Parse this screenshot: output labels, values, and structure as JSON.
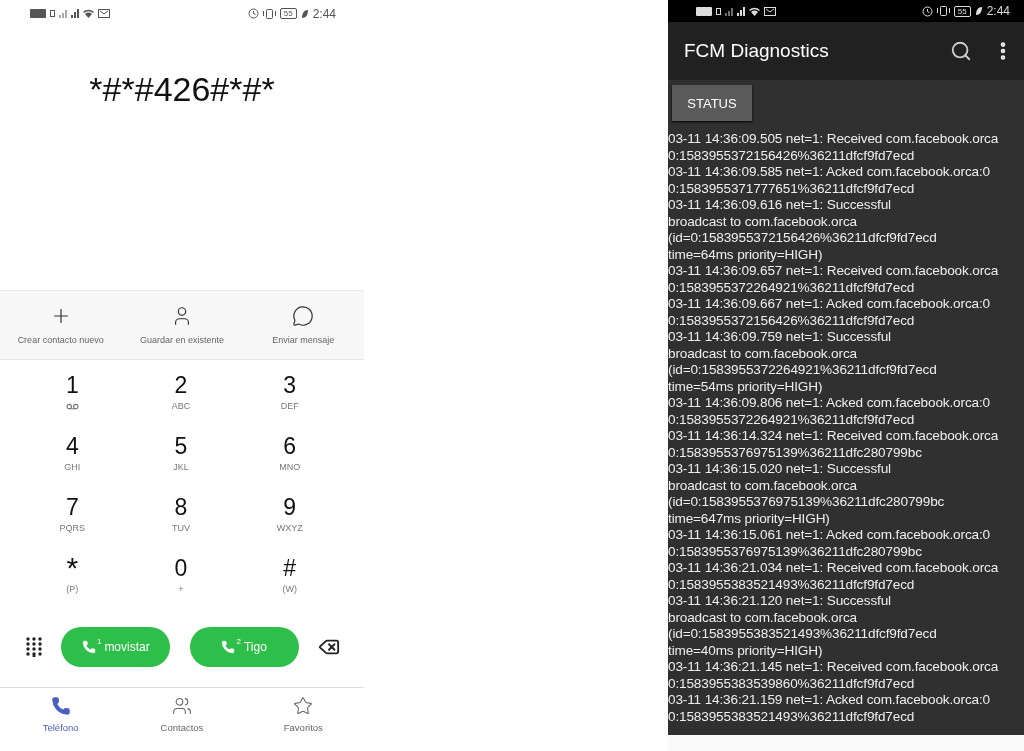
{
  "dialer": {
    "status_bar": {
      "battery": "55",
      "time": "2:44"
    },
    "number": "*#*#426#*#*",
    "actions": [
      {
        "kind": "add",
        "label": "Crear contacto nuevo"
      },
      {
        "kind": "person",
        "label": "Guardar en existente"
      },
      {
        "kind": "message",
        "label": "Enviar mensaje"
      }
    ],
    "keys": [
      {
        "digit": "1",
        "kind": "voicemail"
      },
      {
        "digit": "2",
        "letters": "ABC"
      },
      {
        "digit": "3",
        "letters": "DEF"
      },
      {
        "digit": "4",
        "letters": "GHI"
      },
      {
        "digit": "5",
        "letters": "JKL"
      },
      {
        "digit": "6",
        "letters": "MNO"
      },
      {
        "digit": "7",
        "letters": "PQRS"
      },
      {
        "digit": "8",
        "letters": "TUV"
      },
      {
        "digit": "9",
        "letters": "WXYZ"
      },
      {
        "digit": "*",
        "letters": "(P)"
      },
      {
        "digit": "0",
        "letters": "+"
      },
      {
        "digit": "#",
        "letters": "(W)"
      }
    ],
    "call_buttons": [
      {
        "sim": "1",
        "label": "movistar"
      },
      {
        "sim": "2",
        "label": "Tigo"
      }
    ],
    "tabs": [
      {
        "kind": "phone",
        "label": "Teléfono",
        "selected": true
      },
      {
        "kind": "contacts",
        "label": "Contactos",
        "selected": false
      },
      {
        "kind": "star",
        "label": "Favoritos",
        "selected": false
      }
    ]
  },
  "diagnostics": {
    "status_bar": {
      "battery": "55",
      "time": "2:44"
    },
    "title": "FCM Diagnostics",
    "button": "STATUS",
    "log": [
      "03-11 14:36:09.505 net=1: Received com.facebook.orca",
      "0:1583955372156426%36211dfcf9fd7ecd",
      "03-11 14:36:09.585 net=1: Acked com.facebook.orca:0",
      "0:1583955371777651%36211dfcf9fd7ecd",
      "03-11 14:36:09.616 net=1: Successful",
      "broadcast to com.facebook.orca",
      "(id=0:1583955372156426%36211dfcf9fd7ecd",
      "time=64ms priority=HIGH)",
      "03-11 14:36:09.657 net=1: Received com.facebook.orca",
      "0:1583955372264921%36211dfcf9fd7ecd",
      "03-11 14:36:09.667 net=1: Acked com.facebook.orca:0",
      "0:1583955372156426%36211dfcf9fd7ecd",
      "03-11 14:36:09.759 net=1: Successful",
      "broadcast to com.facebook.orca",
      "(id=0:1583955372264921%36211dfcf9fd7ecd",
      "time=54ms priority=HIGH)",
      "03-11 14:36:09.806 net=1: Acked com.facebook.orca:0",
      "0:1583955372264921%36211dfcf9fd7ecd",
      "03-11 14:36:14.324 net=1: Received com.facebook.orca",
      "0:1583955376975139%36211dfc280799bc",
      "03-11 14:36:15.020 net=1: Successful",
      "broadcast to com.facebook.orca",
      "(id=0:1583955376975139%36211dfc280799bc",
      "time=647ms priority=HIGH)",
      "03-11 14:36:15.061 net=1: Acked com.facebook.orca:0",
      "0:1583955376975139%36211dfc280799bc",
      "03-11 14:36:21.034 net=1: Received com.facebook.orca",
      "0:1583955383521493%36211dfcf9fd7ecd",
      "03-11 14:36:21.120 net=1: Successful",
      "broadcast to com.facebook.orca",
      "(id=0:1583955383521493%36211dfcf9fd7ecd",
      "time=40ms priority=HIGH)",
      "03-11 14:36:21.145 net=1: Received com.facebook.orca",
      "0:1583955383539860%36211dfcf9fd7ecd",
      "03-11 14:36:21.159 net=1: Acked com.facebook.orca:0",
      "0:1583955383521493%36211dfcf9fd7ecd"
    ]
  }
}
